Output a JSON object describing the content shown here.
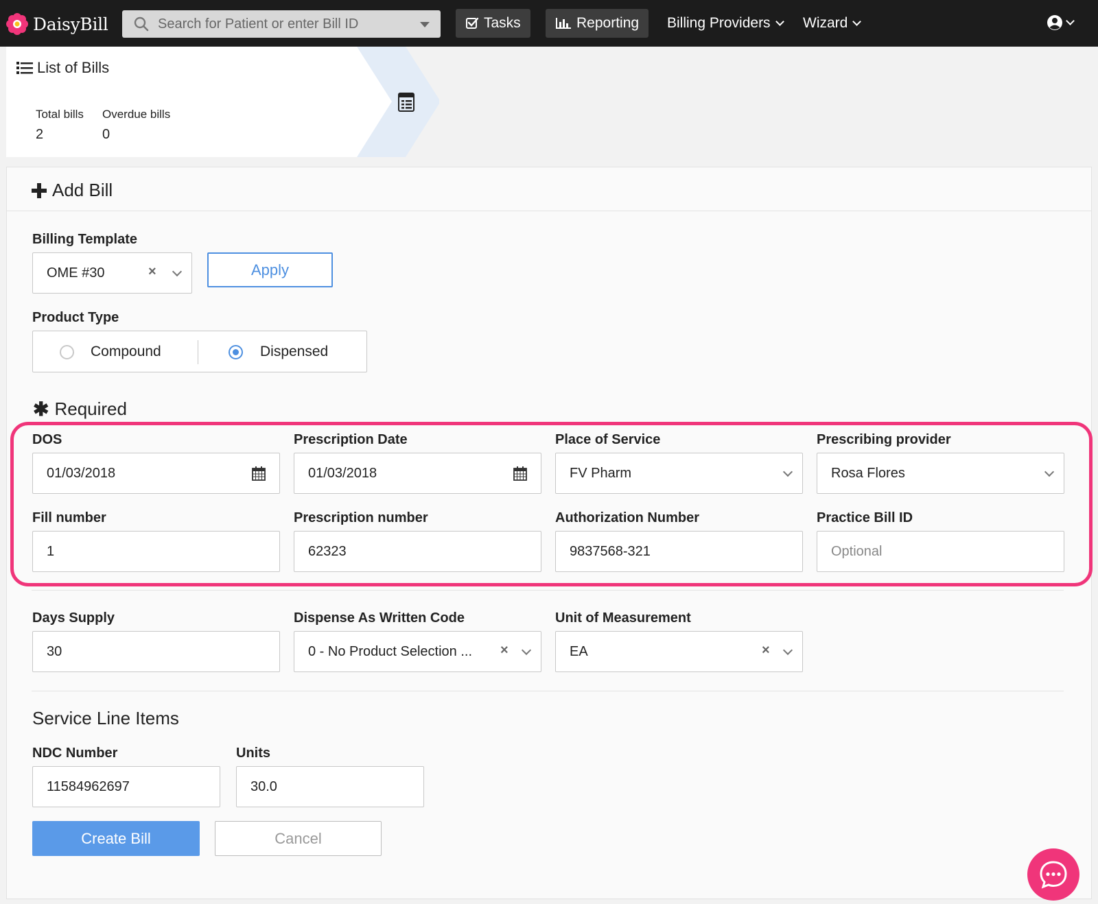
{
  "nav": {
    "logo_text": "DaisyBill",
    "search_placeholder": "Search for Patient or enter Bill ID",
    "tasks_label": "Tasks",
    "reporting_label": "Reporting",
    "billing_providers_label": "Billing Providers",
    "wizard_label": "Wizard"
  },
  "list_header": {
    "title": "List of Bills",
    "stats": [
      {
        "label": "Total bills",
        "value": "2"
      },
      {
        "label": "Overdue bills",
        "value": "0"
      }
    ]
  },
  "add_bill": {
    "title": "Add Bill",
    "billing_template": {
      "label": "Billing Template",
      "value": "OME #30"
    },
    "apply_label": "Apply",
    "product_type": {
      "label": "Product Type",
      "options": [
        {
          "label": "Compound",
          "selected": false
        },
        {
          "label": "Dispensed",
          "selected": true
        }
      ]
    },
    "required_title": "Required",
    "fields": {
      "dos": {
        "label": "DOS",
        "value": "01/03/2018"
      },
      "prescription_date": {
        "label": "Prescription Date",
        "value": "01/03/2018"
      },
      "place_of_service": {
        "label": "Place of Service",
        "value": "FV Pharm"
      },
      "prescribing_provider": {
        "label": "Prescribing provider",
        "value": "Rosa Flores"
      },
      "fill_number": {
        "label": "Fill number",
        "value": "1"
      },
      "prescription_number": {
        "label": "Prescription number",
        "value": "62323"
      },
      "authorization_number": {
        "label": "Authorization Number",
        "value": "9837568-321"
      },
      "practice_bill_id": {
        "label": "Practice Bill ID",
        "placeholder": "Optional"
      },
      "days_supply": {
        "label": "Days Supply",
        "value": "30"
      },
      "daw_code": {
        "label": "Dispense As Written Code",
        "value": "0 - No Product Selection ..."
      },
      "unit_of_measurement": {
        "label": "Unit of Measurement",
        "value": "EA"
      }
    },
    "service_line_items": {
      "title": "Service Line Items",
      "ndc": {
        "label": "NDC Number",
        "value": "11584962697"
      },
      "units": {
        "label": "Units",
        "value": "30.0"
      }
    },
    "create_label": "Create Bill",
    "cancel_label": "Cancel"
  },
  "colors": {
    "accent": "#4d8fe0",
    "highlight": "#f0357a",
    "nav_bg": "#1c1c1c"
  }
}
